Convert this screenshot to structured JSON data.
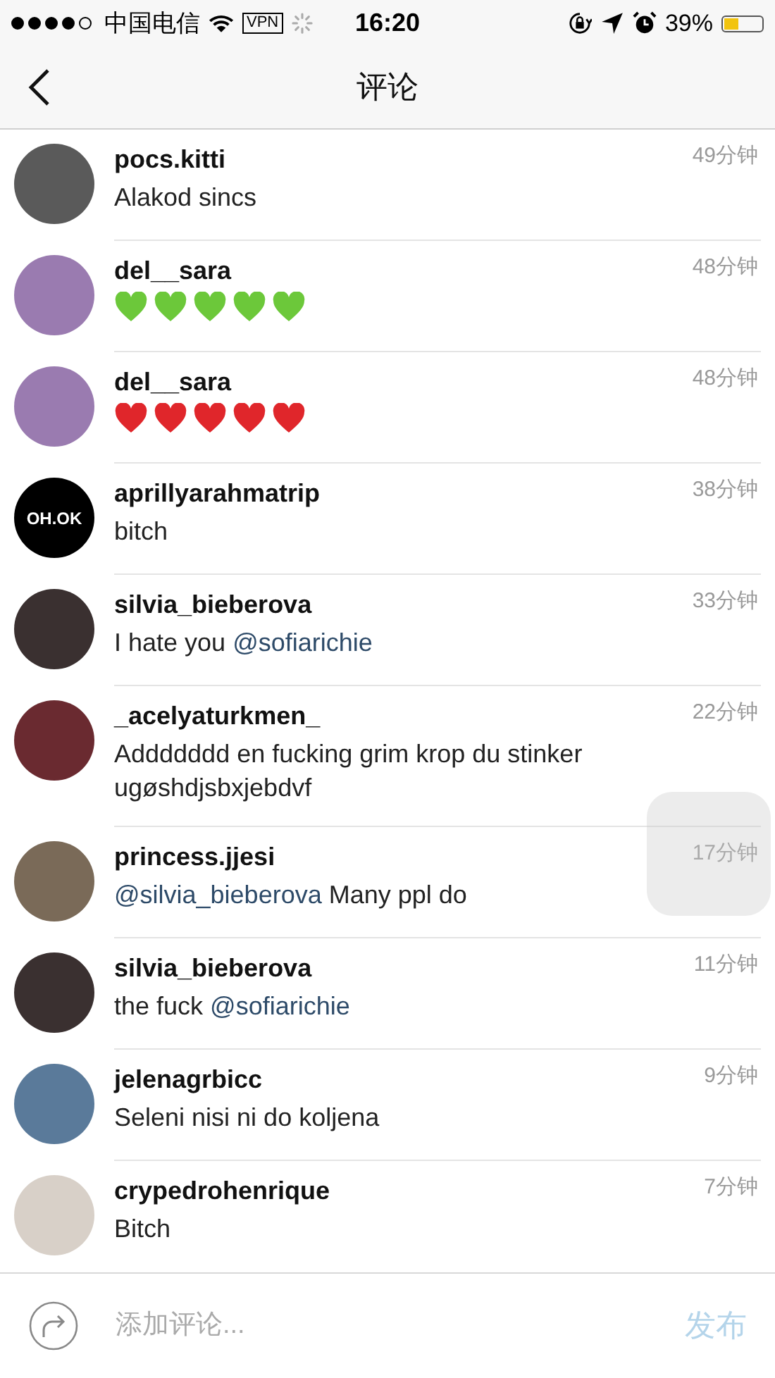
{
  "status_bar": {
    "signal_dots": [
      {
        "filled": true
      },
      {
        "filled": true
      },
      {
        "filled": true
      },
      {
        "filled": true
      },
      {
        "filled": false
      }
    ],
    "carrier": "中国电信",
    "vpn": "VPN",
    "time": "16:20",
    "battery_text": "39%",
    "battery": {
      "level": 0.39
    }
  },
  "nav": {
    "title": "评论"
  },
  "comments": [
    {
      "user": "pocs.kitti",
      "time": "49分钟",
      "avatar": {
        "color": "#5a5a5a"
      },
      "parts": [
        {
          "kind": "text",
          "text": "Alakod sincs"
        }
      ]
    },
    {
      "user": "del__sara",
      "time": "48分钟",
      "avatar": {
        "color": "#9a7bb0"
      },
      "parts": [
        {
          "kind": "heart",
          "color": "#6cc83a"
        },
        {
          "kind": "heart",
          "color": "#6cc83a"
        },
        {
          "kind": "heart",
          "color": "#6cc83a"
        },
        {
          "kind": "heart",
          "color": "#6cc83a"
        },
        {
          "kind": "heart",
          "color": "#6cc83a"
        }
      ]
    },
    {
      "user": "del__sara",
      "time": "48分钟",
      "avatar": {
        "color": "#9a7bb0"
      },
      "parts": [
        {
          "kind": "heart",
          "color": "#e0262b"
        },
        {
          "kind": "heart",
          "color": "#e0262b"
        },
        {
          "kind": "heart",
          "color": "#e0262b"
        },
        {
          "kind": "heart",
          "color": "#e0262b"
        },
        {
          "kind": "heart",
          "color": "#e0262b"
        }
      ]
    },
    {
      "user": "aprillyarahmatrip",
      "time": "38分钟",
      "avatar": {
        "color": "#000000",
        "text": "OH.OK"
      },
      "parts": [
        {
          "kind": "text",
          "text": "bitch"
        }
      ]
    },
    {
      "user": "silvia_bieberova",
      "time": "33分钟",
      "avatar": {
        "color": "#3a3030"
      },
      "parts": [
        {
          "kind": "text",
          "text": "I hate you "
        },
        {
          "kind": "mention",
          "text": "@sofiarichie"
        }
      ]
    },
    {
      "user": "_acelyaturkmen_",
      "time": "22分钟",
      "avatar": {
        "color": "#6a2a30"
      },
      "parts": [
        {
          "kind": "text",
          "text": "Addddddd en fucking grim krop du stinker ugøshdjsbxjebdvf"
        }
      ]
    },
    {
      "user": "princess.jjesi",
      "time": "17分钟",
      "avatar": {
        "color": "#7a6a58"
      },
      "parts": [
        {
          "kind": "mention",
          "text": "@silvia_bieberova"
        },
        {
          "kind": "text",
          "text": " Many ppl do"
        }
      ]
    },
    {
      "user": "silvia_bieberova",
      "time": "11分钟",
      "avatar": {
        "color": "#3a3030"
      },
      "parts": [
        {
          "kind": "text",
          "text": "the fuck "
        },
        {
          "kind": "mention",
          "text": "@sofiarichie"
        }
      ]
    },
    {
      "user": "jelenagrbicc",
      "time": "9分钟",
      "avatar": {
        "color": "#5a7a9a"
      },
      "parts": [
        {
          "kind": "text",
          "text": "Seleni nisi ni do koljena"
        }
      ]
    },
    {
      "user": "crypedrohenrique",
      "time": "7分钟",
      "avatar": {
        "color": "#d8d0c8"
      },
      "parts": [
        {
          "kind": "text",
          "text": "Bitch"
        }
      ]
    }
  ],
  "composer": {
    "placeholder": "添加评论...",
    "send": "发布",
    "send_disabled": true
  }
}
